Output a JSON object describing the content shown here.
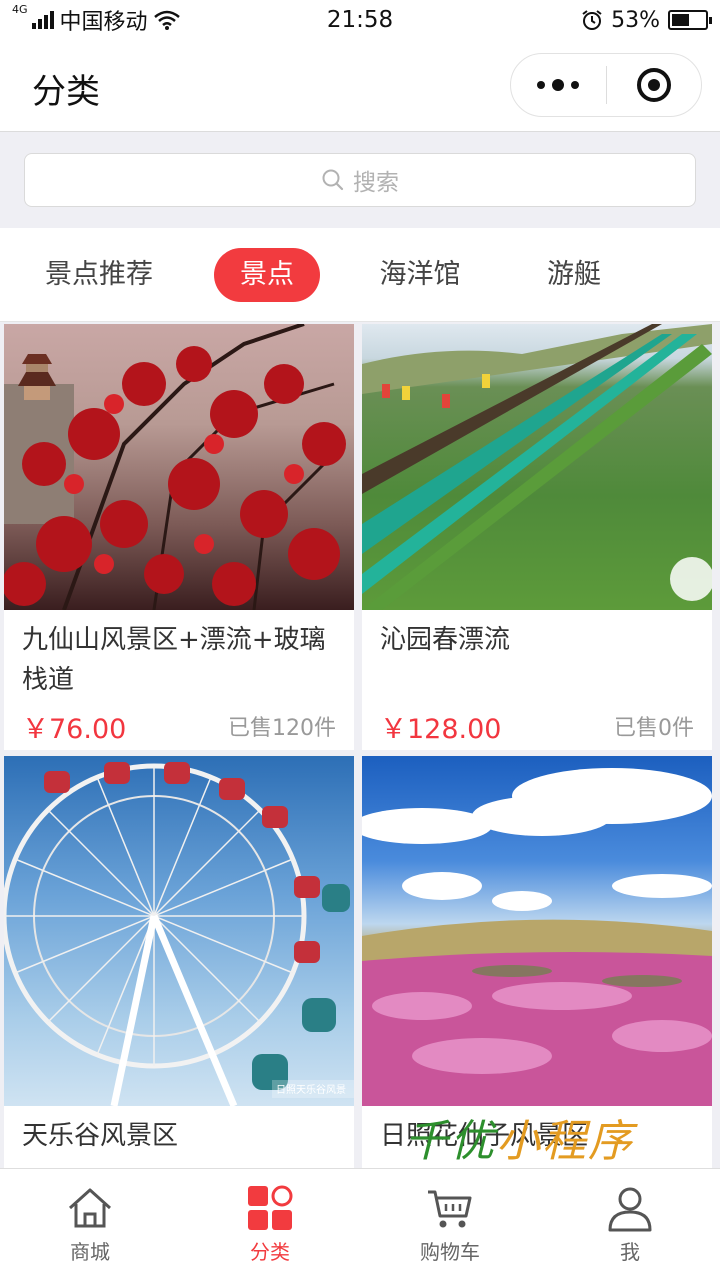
{
  "status_bar": {
    "network_type": "4G",
    "carrier": "中国移动",
    "time": "21:58",
    "battery_percent": "53%",
    "battery_level": 0.53
  },
  "nav": {
    "title": "分类",
    "more_icon": "more-dots-icon",
    "close_icon": "target-circle-icon"
  },
  "search": {
    "placeholder": "搜索",
    "icon": "search-icon"
  },
  "tabs": [
    {
      "label": "景点推荐",
      "active": false
    },
    {
      "label": "景点",
      "active": true
    },
    {
      "label": "海洋馆",
      "active": false
    },
    {
      "label": "游艇",
      "active": false
    }
  ],
  "products": [
    {
      "title": "九仙山风景区+漂流+玻璃栈道",
      "price": "￥76.00",
      "sold": "已售120件"
    },
    {
      "title": "沁园春漂流",
      "price": "￥128.00",
      "sold": "已售0件"
    },
    {
      "title": "天乐谷风景区",
      "price": "",
      "sold": ""
    },
    {
      "title": "日照花仙子风景区",
      "price": "",
      "sold": ""
    }
  ],
  "image_watermark": "日照天乐谷风景",
  "watermark": {
    "part1": "千优",
    "part2": "小程序"
  },
  "tab_bar": [
    {
      "label": "商城",
      "icon": "home-icon",
      "active": false
    },
    {
      "label": "分类",
      "icon": "category-icon",
      "active": true
    },
    {
      "label": "购物车",
      "icon": "cart-icon",
      "active": false
    },
    {
      "label": "我",
      "icon": "user-icon",
      "active": false
    }
  ],
  "colors": {
    "accent": "#f23b3f",
    "background": "#efeff4"
  }
}
